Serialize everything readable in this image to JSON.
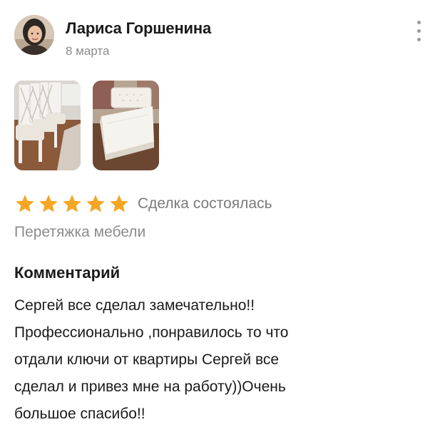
{
  "review": {
    "author_name": "Лариса Горшенина",
    "date": "8 марта",
    "rating": 5,
    "rating_max": 5,
    "deal_status": "Сделка состоялась",
    "service": "Перетяжка мебели",
    "comment_heading": "Комментарий",
    "comment_lines": [
      "Сергей все сделал замечательно!!",
      "Профессионально ,понравилось то что",
      "отдали ключи от квартиры Сергей все",
      "сделал и привез мне на работу))Очень",
      "большое спасибо!!"
    ],
    "photos": [
      "chairs-photo",
      "bed-photo"
    ]
  },
  "icons": {
    "more": "more-vertical-icon",
    "star": "star-icon"
  },
  "colors": {
    "star": "#F5A623",
    "secondary_text": "#8C8C8C",
    "primary_text": "#1A1A1A"
  }
}
